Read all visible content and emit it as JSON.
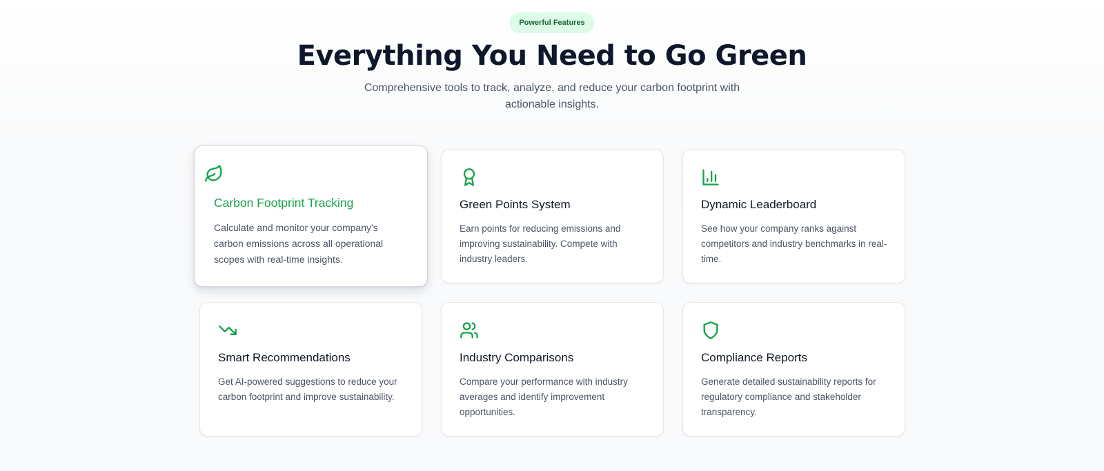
{
  "section": {
    "badge": "Powerful Features",
    "title": "Everything You Need to Go Green",
    "subtitle": "Comprehensive tools to track, analyze, and reduce your carbon footprint with actionable insights."
  },
  "colors": {
    "accent": "#16a34a",
    "badge_bg": "#dcfce7",
    "badge_text": "#166534",
    "heading": "#0f172a",
    "body_text": "#4b5563"
  },
  "features": [
    {
      "icon": "leaf-icon",
      "title": "Carbon Footprint Tracking",
      "description": "Calculate and monitor your company's carbon emissions across all operational scopes with real-time insights."
    },
    {
      "icon": "award-icon",
      "title": "Green Points System",
      "description": "Earn points for reducing emissions and improving sustainability. Compete with industry leaders."
    },
    {
      "icon": "bar-chart-icon",
      "title": "Dynamic Leaderboard",
      "description": "See how your company ranks against competitors and industry benchmarks in real-time."
    },
    {
      "icon": "trending-down-icon",
      "title": "Smart Recommendations",
      "description": "Get AI-powered suggestions to reduce your carbon footprint and improve sustainability."
    },
    {
      "icon": "users-icon",
      "title": "Industry Comparisons",
      "description": "Compare your performance with industry averages and identify improvement opportunities."
    },
    {
      "icon": "shield-icon",
      "title": "Compliance Reports",
      "description": "Generate detailed sustainability reports for regulatory compliance and stakeholder transparency."
    }
  ]
}
